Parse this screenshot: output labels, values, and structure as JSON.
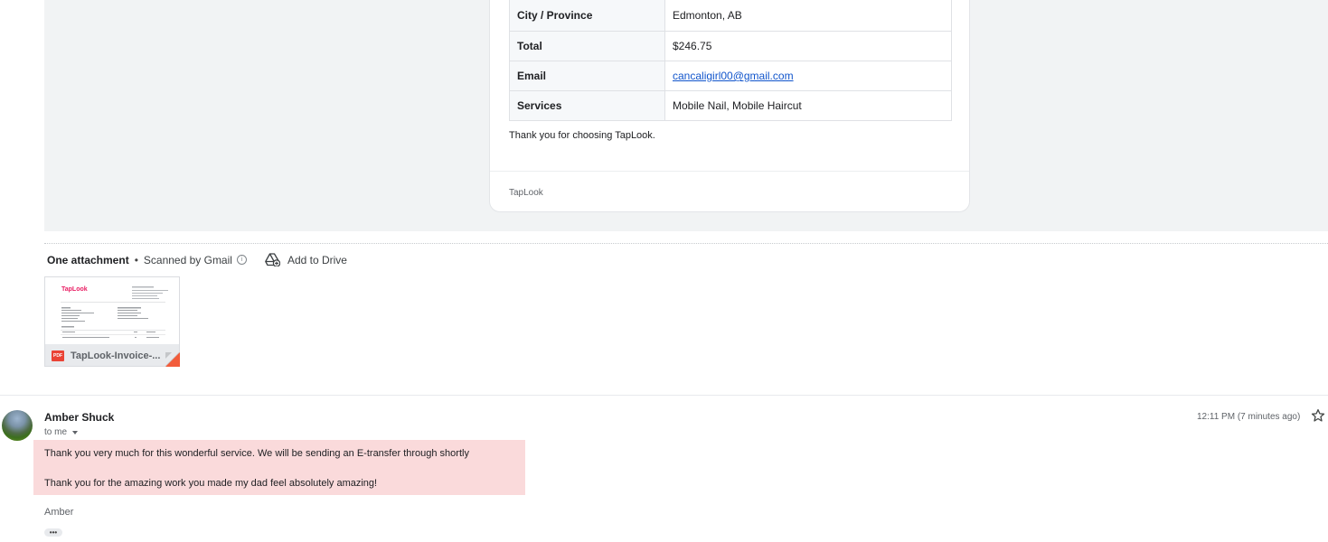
{
  "email_card": {
    "rows": [
      {
        "key": "City / Province",
        "value": "Edmonton, AB"
      },
      {
        "key": "Total",
        "value": "$246.75"
      },
      {
        "key": "Email",
        "value": "cancaligirl00@gmail.com"
      },
      {
        "key": "Services",
        "value": "Mobile Nail, Mobile Haircut"
      }
    ],
    "thanks": "Thank you for choosing TapLook.",
    "footer": "TapLook"
  },
  "attachments": {
    "count_label": "One attachment",
    "separator": "•",
    "scanned_label": "Scanned by Gmail",
    "info_icon": "i",
    "add_to_drive_label": "Add to Drive",
    "file": {
      "type_badge": "PDF",
      "name": "TapLook-Invoice-...",
      "preview_brand": "TapLook"
    }
  },
  "reply": {
    "sender": "Amber Shuck",
    "recipient": "to me",
    "timestamp": "12:11 PM (7 minutes ago)",
    "body_line_1": "Thank you very much for this wonderful service. We will be sending an E-transfer through shortly",
    "body_line_2": "Thank you for the amazing work you made my dad feel absolutely amazing!",
    "signature": "Amber",
    "more_label": "•••"
  },
  "colors": {
    "highlight": "#fadadb",
    "link": "#1155cc",
    "pdf_red": "#ea4335",
    "brand": "#e91e63"
  }
}
